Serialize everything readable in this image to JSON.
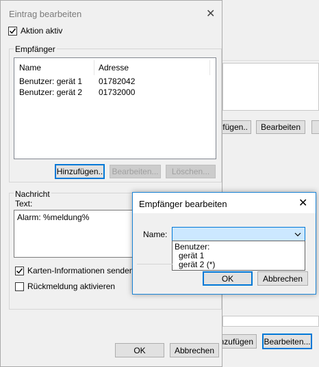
{
  "background": {
    "buttons": {
      "add_partial": "fügen..",
      "edit": "Bearbeiten",
      "add_partial_bottom": "nzufügen",
      "edit_bottom": "Bearbeiten..."
    }
  },
  "dialog": {
    "title": "Eintrag bearbeiten",
    "action_active_label": "Aktion aktiv",
    "action_active_checked": true,
    "recipients": {
      "group_label": "Empfänger",
      "columns": [
        "Name",
        "Adresse"
      ],
      "rows": [
        {
          "name": "Benutzer: gerät 1",
          "address": "01782042"
        },
        {
          "name": "Benutzer: gerät 2",
          "address": "01732000"
        }
      ],
      "add_label": "Hinzufügen..",
      "edit_label": "Bearbeiten...",
      "delete_label": "Löschen..."
    },
    "message": {
      "group_label": "Nachricht",
      "text_label": "Text:",
      "text_value": "Alarm: %meldung%"
    },
    "send_map_info_label": "Karten-Informationen senden",
    "send_map_info_checked": true,
    "feedback_label": "Rückmeldung aktivieren",
    "feedback_checked": false,
    "ok_label": "OK",
    "cancel_label": "Abbrechen"
  },
  "recipient_dialog": {
    "title": "Empfänger bearbeiten",
    "name_label": "Name:",
    "name_value": "",
    "dropdown": {
      "group": "Benutzer:",
      "options": [
        "gerät 1",
        "gerät 2 (*)"
      ]
    },
    "ok_label": "OK",
    "cancel_label": "Abbrechen"
  },
  "colors": {
    "accent": "#0078d7",
    "combo_highlight": "#cce8ff",
    "dialog_bg": "#f0f0f0"
  }
}
